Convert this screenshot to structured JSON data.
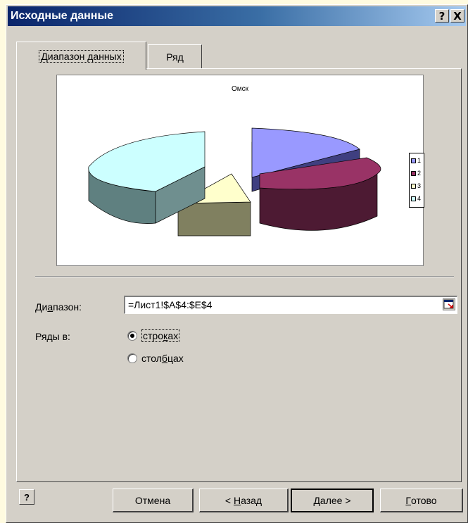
{
  "window": {
    "title": "Исходные данные",
    "help_glyph": "?",
    "close_glyph": "X"
  },
  "tabs": [
    {
      "label": "Диапазон данных",
      "active": true
    },
    {
      "label": "Ряд",
      "active": false
    }
  ],
  "chart_data": {
    "type": "pie",
    "title": "Омск",
    "categories": [
      "1",
      "2",
      "3",
      "4"
    ],
    "values": [
      20,
      25,
      10,
      45
    ],
    "colors": [
      "#9999ff",
      "#993366",
      "#ffffcc",
      "#ccffff"
    ],
    "legend_position": "right"
  },
  "range": {
    "label_pre": "Ди",
    "label_accel": "а",
    "label_post": "пазон:",
    "value": "=Лист1!$A$4:$E$4"
  },
  "series_in": {
    "label": "Ряды в:",
    "options": [
      {
        "pre": "стро",
        "accel": "к",
        "post": "ах",
        "checked": true
      },
      {
        "pre": "стол",
        "accel": "б",
        "post": "цах",
        "checked": false
      }
    ]
  },
  "buttons": {
    "cancel": "Отмена",
    "back_pre": "< ",
    "back_accel": "Н",
    "back_post": "азад",
    "next": "Далее >",
    "finish_accel": "Г",
    "finish_post": "отово"
  },
  "help_icon": "?"
}
